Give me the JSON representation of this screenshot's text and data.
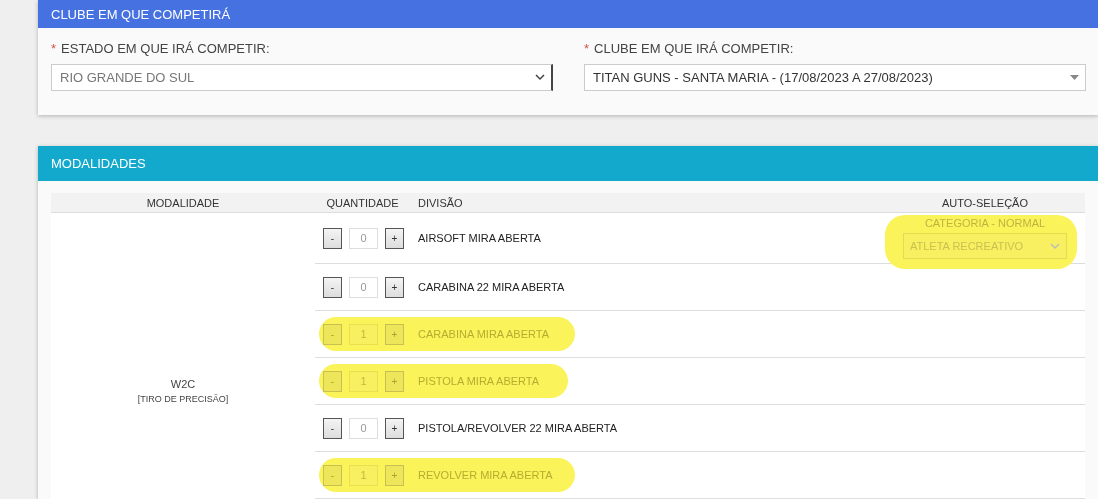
{
  "club_panel": {
    "title": "CLUBE EM QUE COMPETIRÁ",
    "fields": [
      {
        "required_mark": "*",
        "label": "ESTADO EM QUE IRÁ COMPETIR:",
        "value": "RIO GRANDE DO SUL",
        "kind": "native"
      },
      {
        "required_mark": "*",
        "label": "CLUBE EM QUE IRÁ COMPETIR:",
        "value": "TITAN GUNS - SANTA MARIA - (17/08/2023 A 27/08/2023)",
        "kind": "custom"
      }
    ]
  },
  "modalities_panel": {
    "title": "MODALIDADES",
    "columns": [
      "MODALIDADE",
      "QUANTIDADE",
      "DIVISÃO",
      "AUTO-SELEÇÃO"
    ],
    "modality": {
      "name": "W2C",
      "type": "[TIRO DE PRECISÃO]"
    },
    "auto_selection": {
      "label": "CATEGORIA - NORMAL",
      "value": "ATLETA RECREATIVO",
      "highlighted": true
    },
    "rows": [
      {
        "minus": "-",
        "quantity": "0",
        "plus": "+",
        "division": "AIRSOFT MIRA ABERTA",
        "highlighted": false
      },
      {
        "minus": "-",
        "quantity": "0",
        "plus": "+",
        "division": "CARABINA 22 MIRA ABERTA",
        "highlighted": false
      },
      {
        "minus": "-",
        "quantity": "1",
        "plus": "+",
        "division": "CARABINA MIRA ABERTA",
        "highlighted": true
      },
      {
        "minus": "-",
        "quantity": "1",
        "plus": "+",
        "division": "PISTOLA MIRA ABERTA",
        "highlighted": true
      },
      {
        "minus": "-",
        "quantity": "0",
        "plus": "+",
        "division": "PISTOLA/REVOLVER 22 MIRA ABERTA",
        "highlighted": false
      },
      {
        "minus": "-",
        "quantity": "1",
        "plus": "+",
        "division": "REVOLVER MIRA ABERTA",
        "highlighted": true
      }
    ]
  }
}
